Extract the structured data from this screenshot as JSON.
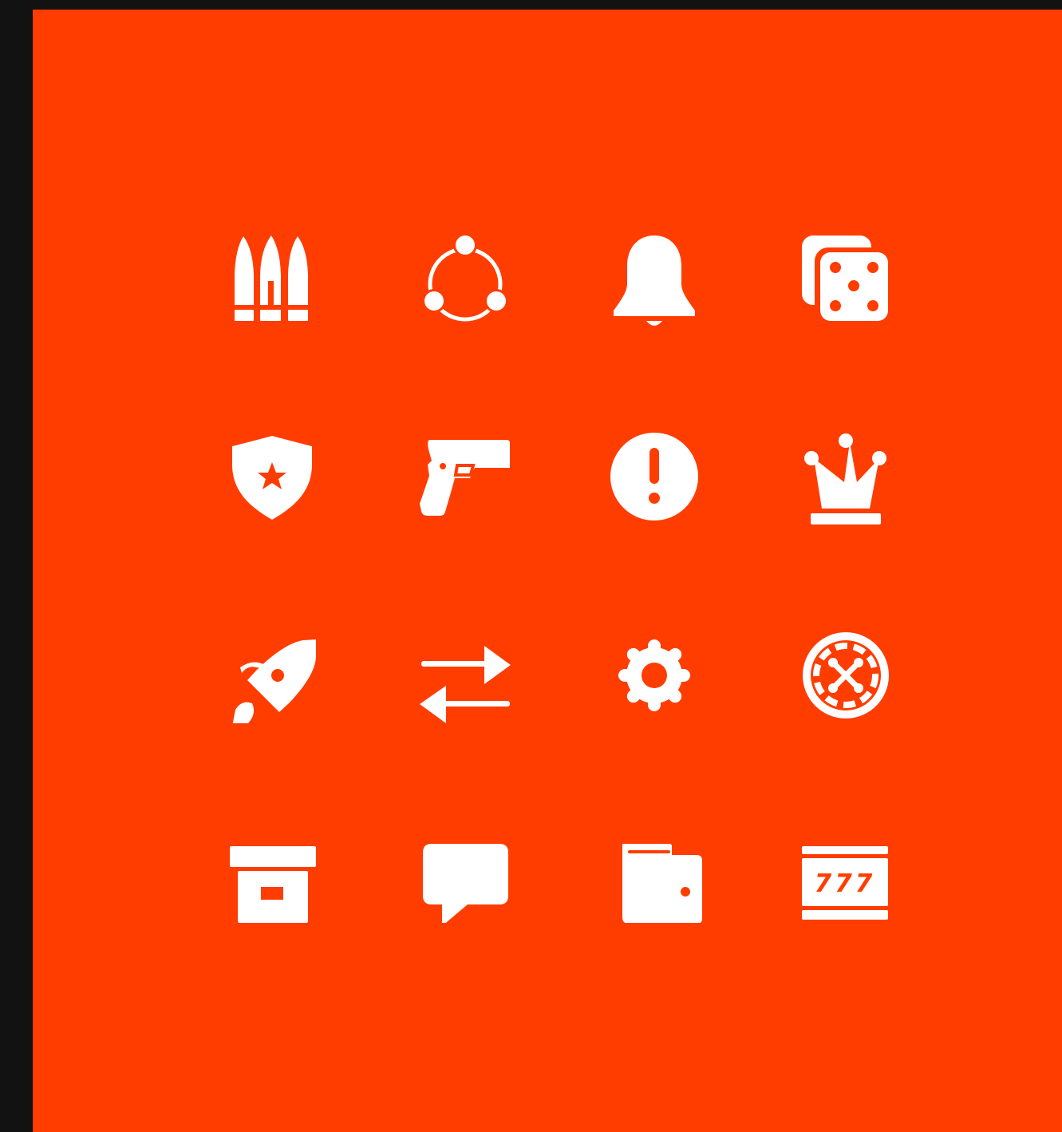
{
  "colors": {
    "background": "#121212",
    "canvas": "#FF3D00",
    "icon": "#FFFFFF"
  },
  "icons": [
    [
      "bullets-icon",
      "share-nodes-icon",
      "bell-icon",
      "dice-icon"
    ],
    [
      "police-badge-icon",
      "pistol-icon",
      "alert-icon",
      "crown-icon"
    ],
    [
      "rocket-icon",
      "transfer-arrows-icon",
      "gear-icon",
      "roulette-icon"
    ],
    [
      "archive-box-icon",
      "chat-bubble-icon",
      "wallet-icon",
      "slot-machine-icon"
    ]
  ],
  "slot_machine": {
    "reels": "777"
  }
}
